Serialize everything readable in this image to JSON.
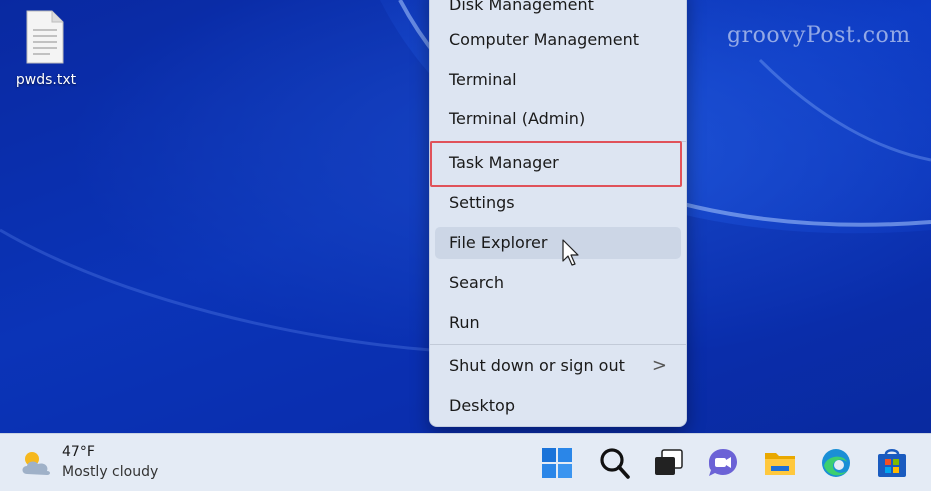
{
  "desktop": {
    "icons": [
      {
        "label": "pwds.txt",
        "icon": "text-file-icon"
      }
    ]
  },
  "watermark": "groovyPost.com",
  "context_menu": {
    "items_top": [
      {
        "label": "Disk Management"
      },
      {
        "label": "Computer Management"
      },
      {
        "label": "Terminal"
      },
      {
        "label": "Terminal (Admin)"
      }
    ],
    "items_middle": [
      {
        "label": "Task Manager",
        "highlighted": true
      },
      {
        "label": "Settings"
      },
      {
        "label": "File Explorer",
        "hovered": true
      },
      {
        "label": "Search"
      },
      {
        "label": "Run"
      }
    ],
    "items_bottom": [
      {
        "label": "Shut down or sign out",
        "submenu_indicator": ">"
      },
      {
        "label": "Desktop"
      }
    ]
  },
  "taskbar": {
    "weather": {
      "temperature": "47°F",
      "condition": "Mostly cloudy",
      "icon": "partly-cloudy-icon"
    },
    "pinned": [
      {
        "icon": "windows-start-icon"
      },
      {
        "icon": "search-icon"
      },
      {
        "icon": "task-view-icon"
      },
      {
        "icon": "teams-chat-icon"
      },
      {
        "icon": "file-explorer-icon"
      },
      {
        "icon": "edge-browser-icon"
      },
      {
        "icon": "microsoft-store-icon"
      }
    ]
  },
  "colors": {
    "highlight_border": "#e0525a",
    "menu_background": "#dde5f2",
    "taskbar_background": "#e4ebf5",
    "desktop_blue": "#0b2fae"
  }
}
